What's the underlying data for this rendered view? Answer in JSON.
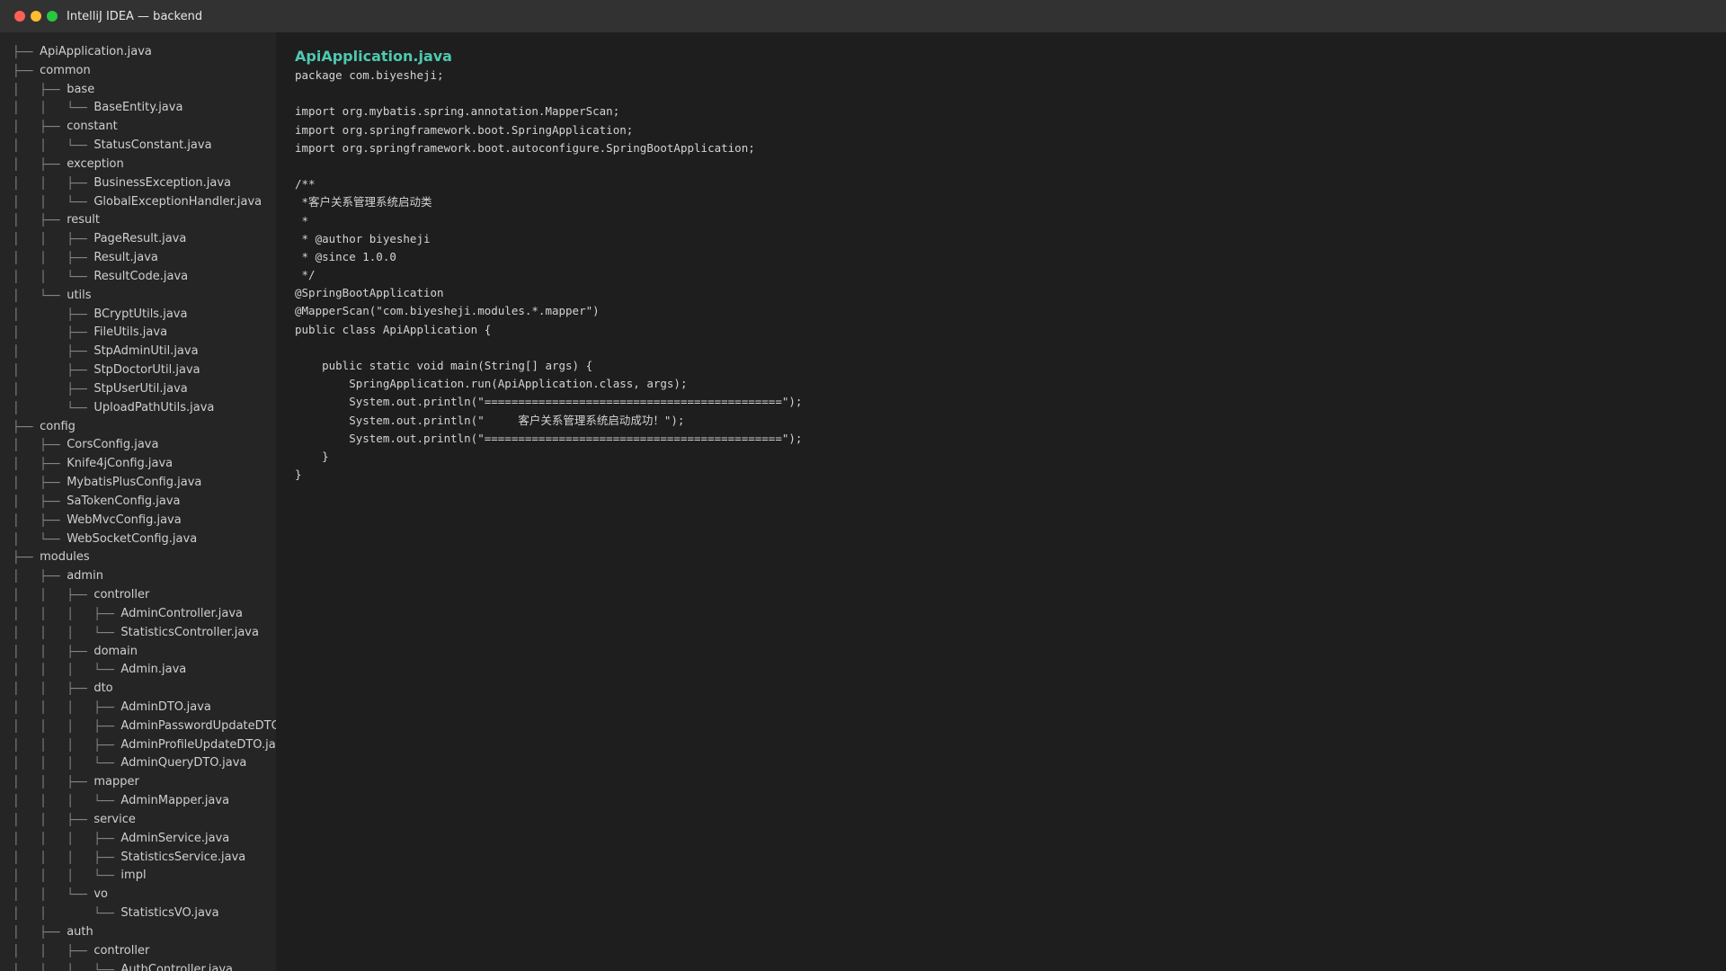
{
  "window": {
    "title": "IntelliJ IDEA — backend",
    "controls": {
      "close_color": "#ff5f57",
      "minimize_color": "#febc2e",
      "maximize_color": "#28c840"
    }
  },
  "sidebar": {
    "items": [
      {
        "prefix": "├── ",
        "name": "ApiApplication.java"
      },
      {
        "prefix": "├── ",
        "name": "common"
      },
      {
        "prefix": "│   ├── ",
        "name": "base"
      },
      {
        "prefix": "│   │   └── ",
        "name": "BaseEntity.java"
      },
      {
        "prefix": "│   ├── ",
        "name": "constant"
      },
      {
        "prefix": "│   │   └── ",
        "name": "StatusConstant.java"
      },
      {
        "prefix": "│   ├── ",
        "name": "exception"
      },
      {
        "prefix": "│   │   ├── ",
        "name": "BusinessException.java"
      },
      {
        "prefix": "│   │   └── ",
        "name": "GlobalExceptionHandler.java"
      },
      {
        "prefix": "│   ├── ",
        "name": "result"
      },
      {
        "prefix": "│   │   ├── ",
        "name": "PageResult.java"
      },
      {
        "prefix": "│   │   ├── ",
        "name": "Result.java"
      },
      {
        "prefix": "│   │   └── ",
        "name": "ResultCode.java"
      },
      {
        "prefix": "│   └── ",
        "name": "utils"
      },
      {
        "prefix": "│       ├── ",
        "name": "BCryptUtils.java"
      },
      {
        "prefix": "│       ├── ",
        "name": "FileUtils.java"
      },
      {
        "prefix": "│       ├── ",
        "name": "StpAdminUtil.java"
      },
      {
        "prefix": "│       ├── ",
        "name": "StpDoctorUtil.java"
      },
      {
        "prefix": "│       ├── ",
        "name": "StpUserUtil.java"
      },
      {
        "prefix": "│       └── ",
        "name": "UploadPathUtils.java"
      },
      {
        "prefix": "├── ",
        "name": "config"
      },
      {
        "prefix": "│   ├── ",
        "name": "CorsConfig.java"
      },
      {
        "prefix": "│   ├── ",
        "name": "Knife4jConfig.java"
      },
      {
        "prefix": "│   ├── ",
        "name": "MybatisPlusConfig.java"
      },
      {
        "prefix": "│   ├── ",
        "name": "SaTokenConfig.java"
      },
      {
        "prefix": "│   ├── ",
        "name": "WebMvcConfig.java"
      },
      {
        "prefix": "│   └── ",
        "name": "WebSocketConfig.java"
      },
      {
        "prefix": "├── ",
        "name": "modules"
      },
      {
        "prefix": "│   ├── ",
        "name": "admin"
      },
      {
        "prefix": "│   │   ├── ",
        "name": "controller"
      },
      {
        "prefix": "│   │   │   ├── ",
        "name": "AdminController.java"
      },
      {
        "prefix": "│   │   │   └── ",
        "name": "StatisticsController.java"
      },
      {
        "prefix": "│   │   ├── ",
        "name": "domain"
      },
      {
        "prefix": "│   │   │   └── ",
        "name": "Admin.java"
      },
      {
        "prefix": "│   │   ├── ",
        "name": "dto"
      },
      {
        "prefix": "│   │   │   ├── ",
        "name": "AdminDTO.java"
      },
      {
        "prefix": "│   │   │   ├── ",
        "name": "AdminPasswordUpdateDTO.java"
      },
      {
        "prefix": "│   │   │   ├── ",
        "name": "AdminProfileUpdateDTO.java"
      },
      {
        "prefix": "│   │   │   └── ",
        "name": "AdminQueryDTO.java"
      },
      {
        "prefix": "│   │   ├── ",
        "name": "mapper"
      },
      {
        "prefix": "│   │   │   └── ",
        "name": "AdminMapper.java"
      },
      {
        "prefix": "│   │   ├── ",
        "name": "service"
      },
      {
        "prefix": "│   │   │   ├── ",
        "name": "AdminService.java"
      },
      {
        "prefix": "│   │   │   ├── ",
        "name": "StatisticsService.java"
      },
      {
        "prefix": "│   │   │   └── ",
        "name": "impl"
      },
      {
        "prefix": "│   │   └── ",
        "name": "vo"
      },
      {
        "prefix": "│   │       └── ",
        "name": "StatisticsVO.java"
      },
      {
        "prefix": "│   ├── ",
        "name": "auth"
      },
      {
        "prefix": "│   │   ├── ",
        "name": "controller"
      },
      {
        "prefix": "│   │   │   └── ",
        "name": "AuthController.java"
      }
    ]
  },
  "editor": {
    "file_title": "ApiApplication.java",
    "lines": [
      "package com.biyesheji;",
      "",
      "import org.mybatis.spring.annotation.MapperScan;",
      "import org.springframework.boot.SpringApplication;",
      "import org.springframework.boot.autoconfigure.SpringBootApplication;",
      "",
      "/**",
      " *客户关系管理系统启动类",
      " *",
      " * @author biyesheji",
      " * @since 1.0.0",
      " */",
      "@SpringBootApplication",
      "@MapperScan(\"com.biyesheji.modules.*.mapper\")",
      "public class ApiApplication {",
      "",
      "    public static void main(String[] args) {",
      "        SpringApplication.run(ApiApplication.class, args);",
      "        System.out.println(\"============================================\");",
      "        System.out.println(\"     客户关系管理系统启动成功！\");",
      "        System.out.println(\"============================================\");",
      "    }",
      "}"
    ]
  }
}
